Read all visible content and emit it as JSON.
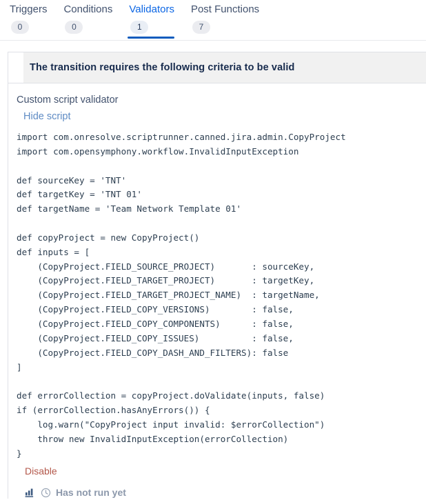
{
  "tabs": [
    {
      "label": "Triggers",
      "count": "0",
      "active": false
    },
    {
      "label": "Conditions",
      "count": "0",
      "active": false
    },
    {
      "label": "Validators",
      "count": "1",
      "active": true
    },
    {
      "label": "Post Functions",
      "count": "7",
      "active": false
    }
  ],
  "panel": {
    "header_title": "The transition requires the following criteria to be valid",
    "validator_name": "Custom script validator",
    "hide_script_label": "Hide script",
    "disable_label": "Disable",
    "run_status_text": "Has not run yet",
    "icons": {
      "chart": "bar-chart-icon",
      "clock": "clock-icon"
    },
    "script_lines": [
      "import com.onresolve.scriptrunner.canned.jira.admin.CopyProject",
      "import com.opensymphony.workflow.InvalidInputException",
      "",
      "def sourceKey = 'TNT'",
      "def targetKey = 'TNT 01'",
      "def targetName = 'Team Network Template 01'",
      "",
      "def copyProject = new CopyProject()",
      "def inputs = [",
      "    (CopyProject.FIELD_SOURCE_PROJECT)       : sourceKey,",
      "    (CopyProject.FIELD_TARGET_PROJECT)       : targetKey,",
      "    (CopyProject.FIELD_TARGET_PROJECT_NAME)  : targetName,",
      "    (CopyProject.FIELD_COPY_VERSIONS)        : false,",
      "    (CopyProject.FIELD_COPY_COMPONENTS)      : false,",
      "    (CopyProject.FIELD_COPY_ISSUES)          : false,",
      "    (CopyProject.FIELD_COPY_DASH_AND_FILTERS): false",
      "]",
      "",
      "def errorCollection = copyProject.doValidate(inputs, false)",
      "if (errorCollection.hasAnyErrors()) {",
      "    log.warn(\"CopyProject input invalid: $errorCollection\")",
      "    throw new InvalidInputException(errorCollection)",
      "}"
    ]
  },
  "colors": {
    "accent_blue": "#0c5bbd",
    "link_blue": "#5e8bc4",
    "disable_red": "#b3574a",
    "header_grey": "#f1f1f1",
    "muted_text": "#8c98ab"
  }
}
